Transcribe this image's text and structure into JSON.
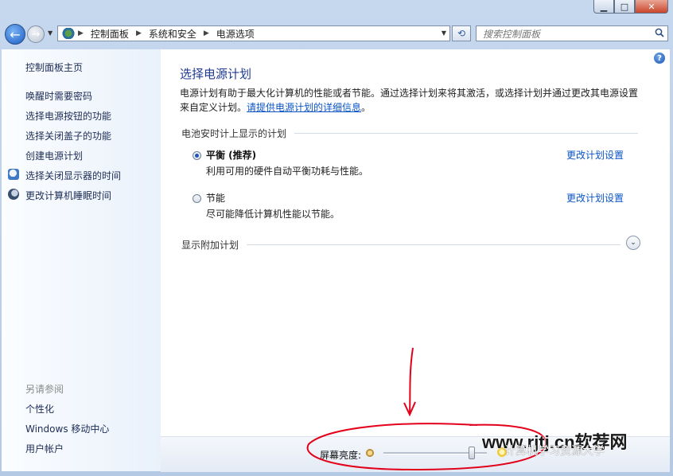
{
  "nav": {
    "breadcrumb": [
      "控制面板",
      "系统和安全",
      "电源选项"
    ],
    "search_placeholder": "搜索控制面板"
  },
  "sidebar": {
    "home": "控制面板主页",
    "items": [
      "唤醒时需要密码",
      "选择电源按钮的功能",
      "选择关闭盖子的功能",
      "创建电源计划",
      "选择关闭显示器的时间",
      "更改计算机睡眠时间"
    ],
    "see_also_heading": "另请参阅",
    "see_also": [
      "个性化",
      "Windows 移动中心",
      "用户帐户"
    ]
  },
  "main": {
    "title": "选择电源计划",
    "desc_text": "电源计划有助于最大化计算机的性能或者节能。通过选择计划来将其激活，或选择计划并通过更改其电源设置来自定义计划。",
    "desc_link": "请提供电源计划的详细信息",
    "desc_end": "。",
    "section_label": "电池安时计上显示的计划",
    "plans": [
      {
        "name": "平衡 (推荐)",
        "desc": "利用可用的硬件自动平衡功耗与性能。",
        "link": "更改计划设置",
        "selected": true
      },
      {
        "name": "节能",
        "desc": "尽可能降低计算机性能以节能。",
        "link": "更改计划设置",
        "selected": false
      }
    ],
    "more_plans": "显示附加计划"
  },
  "bottom": {
    "brightness_label": "屏幕亮度:",
    "brightness_level": 0.85
  },
  "watermark": {
    "main": "www.rjtj.cn软荐网",
    "sub": "计算机学习资源大学"
  },
  "colors": {
    "link": "#0a54c7",
    "title": "#1f3a93",
    "annotation": "#e3001b"
  }
}
